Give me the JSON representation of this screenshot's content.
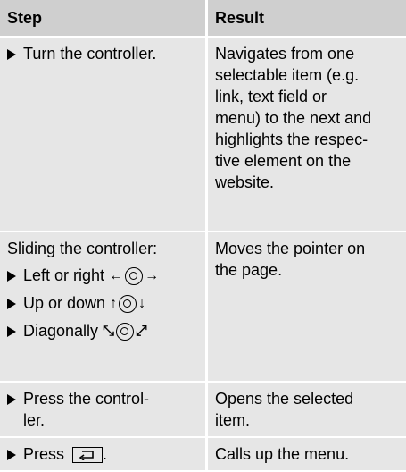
{
  "table": {
    "headers": [
      "Step",
      "Result"
    ],
    "rows": [
      {
        "step": {
          "line1": "Turn the controller."
        },
        "result": [
          "Navigates from one",
          "selectable item (e.g.",
          "link, text field or",
          "menu) to the next and",
          "highlights the respec-",
          "tive element on the",
          "website."
        ]
      },
      {
        "step": {
          "intro": "Sliding the controller:",
          "item1": "Left or right",
          "item2": "Up or down",
          "item3": "Diagonally"
        },
        "result": [
          "Moves the pointer on",
          "the page."
        ]
      },
      {
        "step": {
          "line1": "Press the control-",
          "line2": "ler."
        },
        "result": [
          "Opens the selected",
          "item."
        ]
      },
      {
        "step": {
          "prefix": "Press",
          "suffix": "."
        },
        "result": [
          "Calls up the menu."
        ]
      }
    ]
  },
  "icons": {
    "bullet": "triangle-bullet-icon",
    "controller": "controller-icon",
    "back": "back-button-icon"
  }
}
